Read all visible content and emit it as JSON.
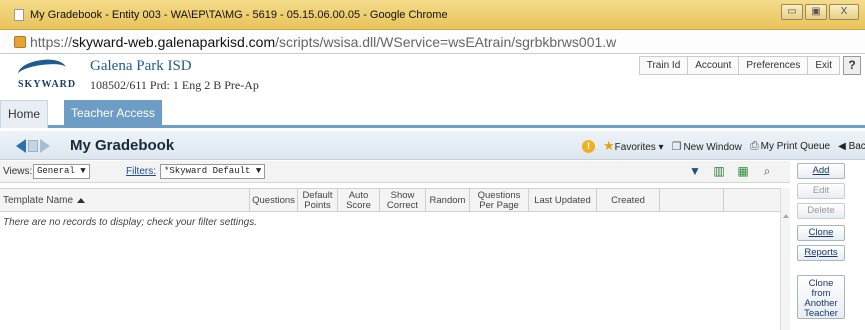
{
  "browser": {
    "title": "My Gradebook - Entity 003 - WA\\EP\\TA\\MG - 5619 - 05.15.06.00.05 - Google Chrome",
    "url_scheme": "https://",
    "url_host": "skyward-web.galenaparkisd.com",
    "url_path": "/scripts/wsisa.dll/WService=wsEAtrain/sgrbkbrws001.w",
    "controls": {
      "minimize": "▭",
      "maximize": "▣",
      "close": "X"
    }
  },
  "header": {
    "logo_text": "SKYWARD",
    "district": "Galena Park ISD",
    "context": "108502/611  Prd: 1  Eng 2 B Pre-Ap",
    "links": [
      "Train Id",
      "Account",
      "Preferences",
      "Exit"
    ],
    "help": "?"
  },
  "nav": {
    "tabs": [
      "Home",
      "Teacher Access"
    ]
  },
  "page": {
    "title": "My Gradebook",
    "tools": {
      "favorites": "Favorites ▾",
      "new_window": "New Window",
      "print_queue": "My Print Queue",
      "back": "◀ Back"
    }
  },
  "filters": {
    "views_label": "Views:",
    "views_value": "General ▼",
    "filters_label": "Filters:",
    "filters_value": "*Skyward Default ▼"
  },
  "grid": {
    "columns": [
      "Template Name",
      "Questions",
      "Default Points",
      "Auto Score",
      "Show Correct",
      "Random",
      "Questions Per Page",
      "Last Updated",
      "Created"
    ],
    "empty_message": "There are no records to display; check your filter settings."
  },
  "actions": {
    "add": "Add",
    "edit": "Edit",
    "delete": "Delete",
    "clone": "Clone",
    "reports": "Reports",
    "clone_from": "Clone from Another Teacher"
  },
  "colors": {
    "nav_accent": "#6d9cc4",
    "title_bar": "#e8c35a",
    "link": "#1a4fa0"
  }
}
